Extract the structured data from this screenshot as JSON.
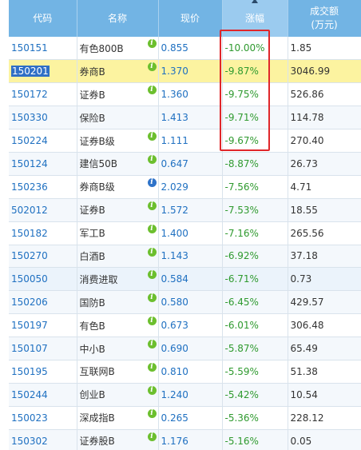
{
  "headers": {
    "code": "代码",
    "name": "名称",
    "price": "现价",
    "change": "涨幅",
    "volume_line1": "成交额",
    "volume_line2": "(万元)"
  },
  "sorted_column": "change",
  "colors": {
    "header_bg": "#72b4e4",
    "code_link": "#1f70c1",
    "negative_change": "#2f9a2f",
    "highlight_row": "#fcf3a0",
    "annotation_box": "#e0262a",
    "info_icon_green": "#6cbf2e",
    "info_icon_blue": "#2e73c9"
  },
  "rows": [
    {
      "code": "150151",
      "name": "有色800B",
      "price": "0.855",
      "change": "-10.00%",
      "volume": "1.85",
      "icon": "info-green",
      "state": "normal"
    },
    {
      "code": "150201",
      "name": "券商B",
      "price": "1.370",
      "change": "-9.87%",
      "volume": "3046.99",
      "icon": "info-green",
      "state": "highlight",
      "code_selected": true
    },
    {
      "code": "150172",
      "name": "证券B",
      "price": "1.360",
      "change": "-9.75%",
      "volume": "526.86",
      "icon": "info-green",
      "state": "normal"
    },
    {
      "code": "150330",
      "name": "保险B",
      "price": "1.413",
      "change": "-9.71%",
      "volume": "114.78",
      "icon": "none",
      "state": "normal"
    },
    {
      "code": "150224",
      "name": "证券B级",
      "price": "1.111",
      "change": "-9.67%",
      "volume": "270.40",
      "icon": "info-green",
      "state": "normal"
    },
    {
      "code": "150124",
      "name": "建信50B",
      "price": "0.647",
      "change": "-8.87%",
      "volume": "26.73",
      "icon": "info-green",
      "state": "normal"
    },
    {
      "code": "150236",
      "name": "券商B级",
      "price": "2.029",
      "change": "-7.56%",
      "volume": "4.71",
      "icon": "info-blue",
      "state": "normal"
    },
    {
      "code": "502012",
      "name": "证券B",
      "price": "1.572",
      "change": "-7.53%",
      "volume": "18.55",
      "icon": "info-green",
      "state": "normal"
    },
    {
      "code": "150182",
      "name": "军工B",
      "price": "1.400",
      "change": "-7.16%",
      "volume": "265.56",
      "icon": "info-green",
      "state": "normal"
    },
    {
      "code": "150270",
      "name": "白酒B",
      "price": "1.143",
      "change": "-6.92%",
      "volume": "37.18",
      "icon": "info-green",
      "state": "normal"
    },
    {
      "code": "150050",
      "name": "消费进取",
      "price": "0.584",
      "change": "-6.71%",
      "volume": "0.73",
      "icon": "info-green",
      "state": "hover"
    },
    {
      "code": "150206",
      "name": "国防B",
      "price": "0.580",
      "change": "-6.45%",
      "volume": "429.57",
      "icon": "info-green",
      "state": "normal"
    },
    {
      "code": "150197",
      "name": "有色B",
      "price": "0.673",
      "change": "-6.01%",
      "volume": "306.48",
      "icon": "info-green",
      "state": "normal"
    },
    {
      "code": "150107",
      "name": "中小B",
      "price": "0.690",
      "change": "-5.87%",
      "volume": "65.49",
      "icon": "info-green",
      "state": "normal"
    },
    {
      "code": "150195",
      "name": "互联网B",
      "price": "0.810",
      "change": "-5.59%",
      "volume": "51.38",
      "icon": "info-green",
      "state": "normal"
    },
    {
      "code": "150244",
      "name": "创业B",
      "price": "1.240",
      "change": "-5.42%",
      "volume": "10.54",
      "icon": "info-green",
      "state": "normal"
    },
    {
      "code": "150023",
      "name": "深成指B",
      "price": "0.265",
      "change": "-5.36%",
      "volume": "228.12",
      "icon": "info-green",
      "state": "normal"
    },
    {
      "code": "150302",
      "name": "证券股B",
      "price": "1.176",
      "change": "-5.16%",
      "volume": "0.05",
      "icon": "info-green",
      "state": "normal"
    }
  ]
}
